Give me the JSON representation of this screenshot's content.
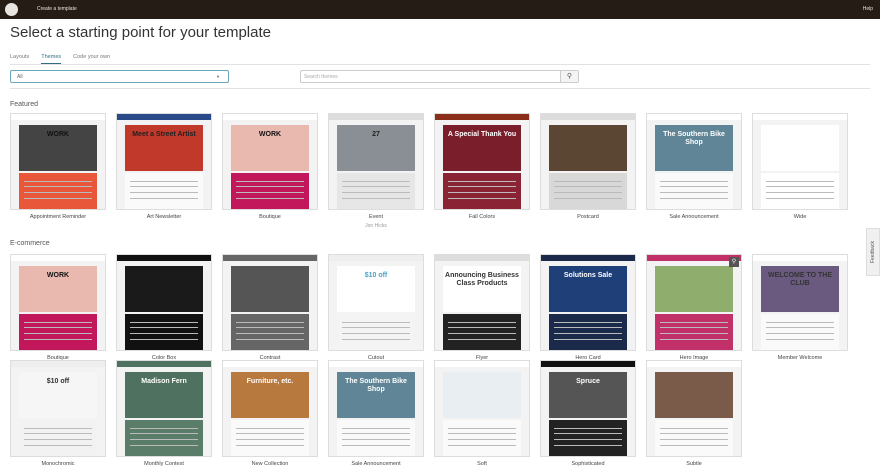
{
  "topbar": {
    "title": "Create a template",
    "help": "Help",
    "logo": "C"
  },
  "page_title": "Select a starting point for your template",
  "tabs": [
    {
      "label": "Layouts"
    },
    {
      "label": "Themes",
      "active": true
    },
    {
      "label": "Code your own"
    }
  ],
  "filter": {
    "value": "All"
  },
  "search": {
    "placeholder": "Search themes",
    "icon": "search-icon"
  },
  "feedback": "Feedback",
  "sections": [
    {
      "title": "Featured",
      "cards": [
        {
          "name": "Appointment Reminder",
          "bar": "#fff",
          "hero": "#444",
          "body": "#e8573a",
          "headline": "WORK",
          "hlcolor": "#111"
        },
        {
          "name": "Art Newsletter",
          "bar": "#2b4a8a",
          "hero": "#c0392b",
          "body": "#fafafa",
          "headline": "Meet a Street Artist",
          "hlcolor": "#222"
        },
        {
          "name": "Boutique",
          "bar": "#fff",
          "hero": "#e9b9b0",
          "body": "#c2185b",
          "headline": "WORK",
          "hlcolor": "#111"
        },
        {
          "name": "Event",
          "sub": "Jon Hicks",
          "bar": "#ddd",
          "hero": "#8a8f95",
          "body": "#e6e6e6",
          "headline": "27",
          "hlcolor": "#222"
        },
        {
          "name": "Fall Colors",
          "bar": "#8b2f1a",
          "hero": "#7a1e2c",
          "body": "#8a2334",
          "headline": "A Special Thank You",
          "hlcolor": "#fff"
        },
        {
          "name": "Postcard",
          "bar": "#dcdcdc",
          "hero": "#5a4633",
          "body": "#d8d8d8",
          "headline": "",
          "hlcolor": "#fff"
        },
        {
          "name": "Sale Announcement",
          "bar": "#fff",
          "hero": "#5f8596",
          "body": "#fafafa",
          "headline": "The Southern Bike Shop",
          "hlcolor": "#fff"
        },
        {
          "name": "Wide",
          "bar": "#fff",
          "hero": "#fff",
          "body": "#fff",
          "headline": "",
          "hlcolor": "#333"
        }
      ]
    },
    {
      "title": "E-commerce",
      "cards": [
        {
          "name": "Boutique",
          "bar": "#fff",
          "hero": "#e9b9b0",
          "body": "#c2185b",
          "headline": "WORK",
          "hlcolor": "#111"
        },
        {
          "name": "Color Box",
          "bar": "#111",
          "hero": "#1a1a1a",
          "body": "#111",
          "headline": "",
          "hlcolor": "#fff"
        },
        {
          "name": "Contrast",
          "bar": "#666",
          "hero": "#555",
          "body": "#666",
          "headline": "",
          "hlcolor": "#fff"
        },
        {
          "name": "Cutout",
          "bar": "#eee",
          "hero": "#fff",
          "body": "#f4f4f4",
          "headline": "$10 off",
          "hlcolor": "#4aa3c8"
        },
        {
          "name": "Flyer",
          "bar": "#ddd",
          "hero": "#fff",
          "body": "#222",
          "headline": "Announcing Business Class Products",
          "hlcolor": "#333"
        },
        {
          "name": "Hero Card",
          "bar": "#1b2a4a",
          "hero": "#1e3f78",
          "body": "#1b2a4a",
          "headline": "Solutions Sale",
          "hlcolor": "#fff"
        },
        {
          "name": "Hero Image",
          "bar": "#c2306a",
          "hero": "#8fae6e",
          "body": "#c2306a",
          "headline": "",
          "hlcolor": "#fff",
          "zoom": true
        },
        {
          "name": "Member Welcome",
          "bar": "#fff",
          "hero": "#6a5a80",
          "body": "#fafafa",
          "headline": "WELCOME TO THE CLUB",
          "hlcolor": "#333"
        }
      ]
    },
    {
      "title": "",
      "cards": [
        {
          "name": "Monochromic",
          "bar": "#eee",
          "hero": "#f6f6f6",
          "body": "#f2f2f2",
          "headline": "$10 off",
          "hlcolor": "#333"
        },
        {
          "name": "Monthly Contest",
          "bar": "#4f7260",
          "hero": "#4f7260",
          "body": "#5a7d6a",
          "headline": "Madison Fern",
          "hlcolor": "#fff"
        },
        {
          "name": "New Collection",
          "bar": "#fff",
          "hero": "#b8793f",
          "body": "#fafafa",
          "headline": "Furniture, etc.",
          "hlcolor": "#fff"
        },
        {
          "name": "Sale Announcement",
          "bar": "#fff",
          "hero": "#5f8596",
          "body": "#fafafa",
          "headline": "The Southern Bike Shop",
          "hlcolor": "#fff"
        },
        {
          "name": "Soft",
          "bar": "#fff",
          "hero": "#e9eef2",
          "body": "#fafafa",
          "headline": "",
          "hlcolor": "#333"
        },
        {
          "name": "Sophisticated",
          "bar": "#111",
          "hero": "#555",
          "body": "#222",
          "headline": "Spruce",
          "hlcolor": "#fff"
        },
        {
          "name": "Subtle",
          "bar": "#fff",
          "hero": "#7a5a48",
          "body": "#fafafa",
          "headline": "",
          "hlcolor": "#fff"
        }
      ]
    }
  ]
}
